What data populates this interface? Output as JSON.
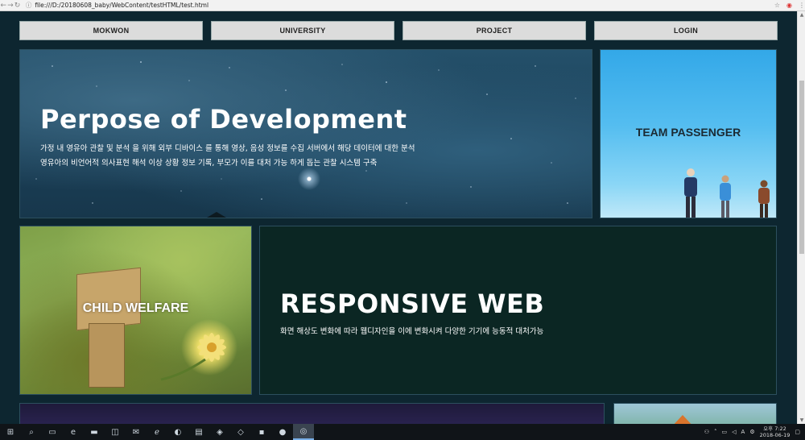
{
  "browser": {
    "back_icon": "back-arrow-icon",
    "forward_icon": "forward-arrow-icon",
    "reload_icon": "reload-icon",
    "info_icon": "info-icon",
    "url": "file:///D:/20180608_baby/WebContent/testHTML/test.html"
  },
  "nav": {
    "items": [
      {
        "label": "MOKWON"
      },
      {
        "label": "UNIVERSITY"
      },
      {
        "label": "PROJECT"
      },
      {
        "label": "LOGIN"
      }
    ]
  },
  "hero": {
    "title": "Perpose of Development",
    "line1": "가정 내 영유아 관찰 및 분석 을 위해 외부 디바이스 를 통해 영상, 음성 정보를 수집 서버에서 해당 데이터에 대한 분석",
    "line2": "영유아의 비언어적 의사표현 해석 이상 상황 정보 기록, 부모가 이를 대처 가능 하게 돕는 관찰 시스템 구축"
  },
  "team": {
    "title": "TEAM PASSENGER"
  },
  "child": {
    "label": "CHILD WELFARE"
  },
  "responsive": {
    "title": "RESPONSIVE WEB",
    "desc": "화면 해상도 변화에 따라 웹디자인을 이에 변화시켜 다양한 기기에 능동적 대처가능"
  },
  "taskbar": {
    "clock_period_time": "오후 7:22",
    "clock_date": "2018-06-19"
  },
  "colors": {
    "page_bg": "#0d2630",
    "nav_button_bg": "#dcdcdc",
    "responsive_bg": "#0b2623",
    "team_sky": "#54bdf0"
  }
}
